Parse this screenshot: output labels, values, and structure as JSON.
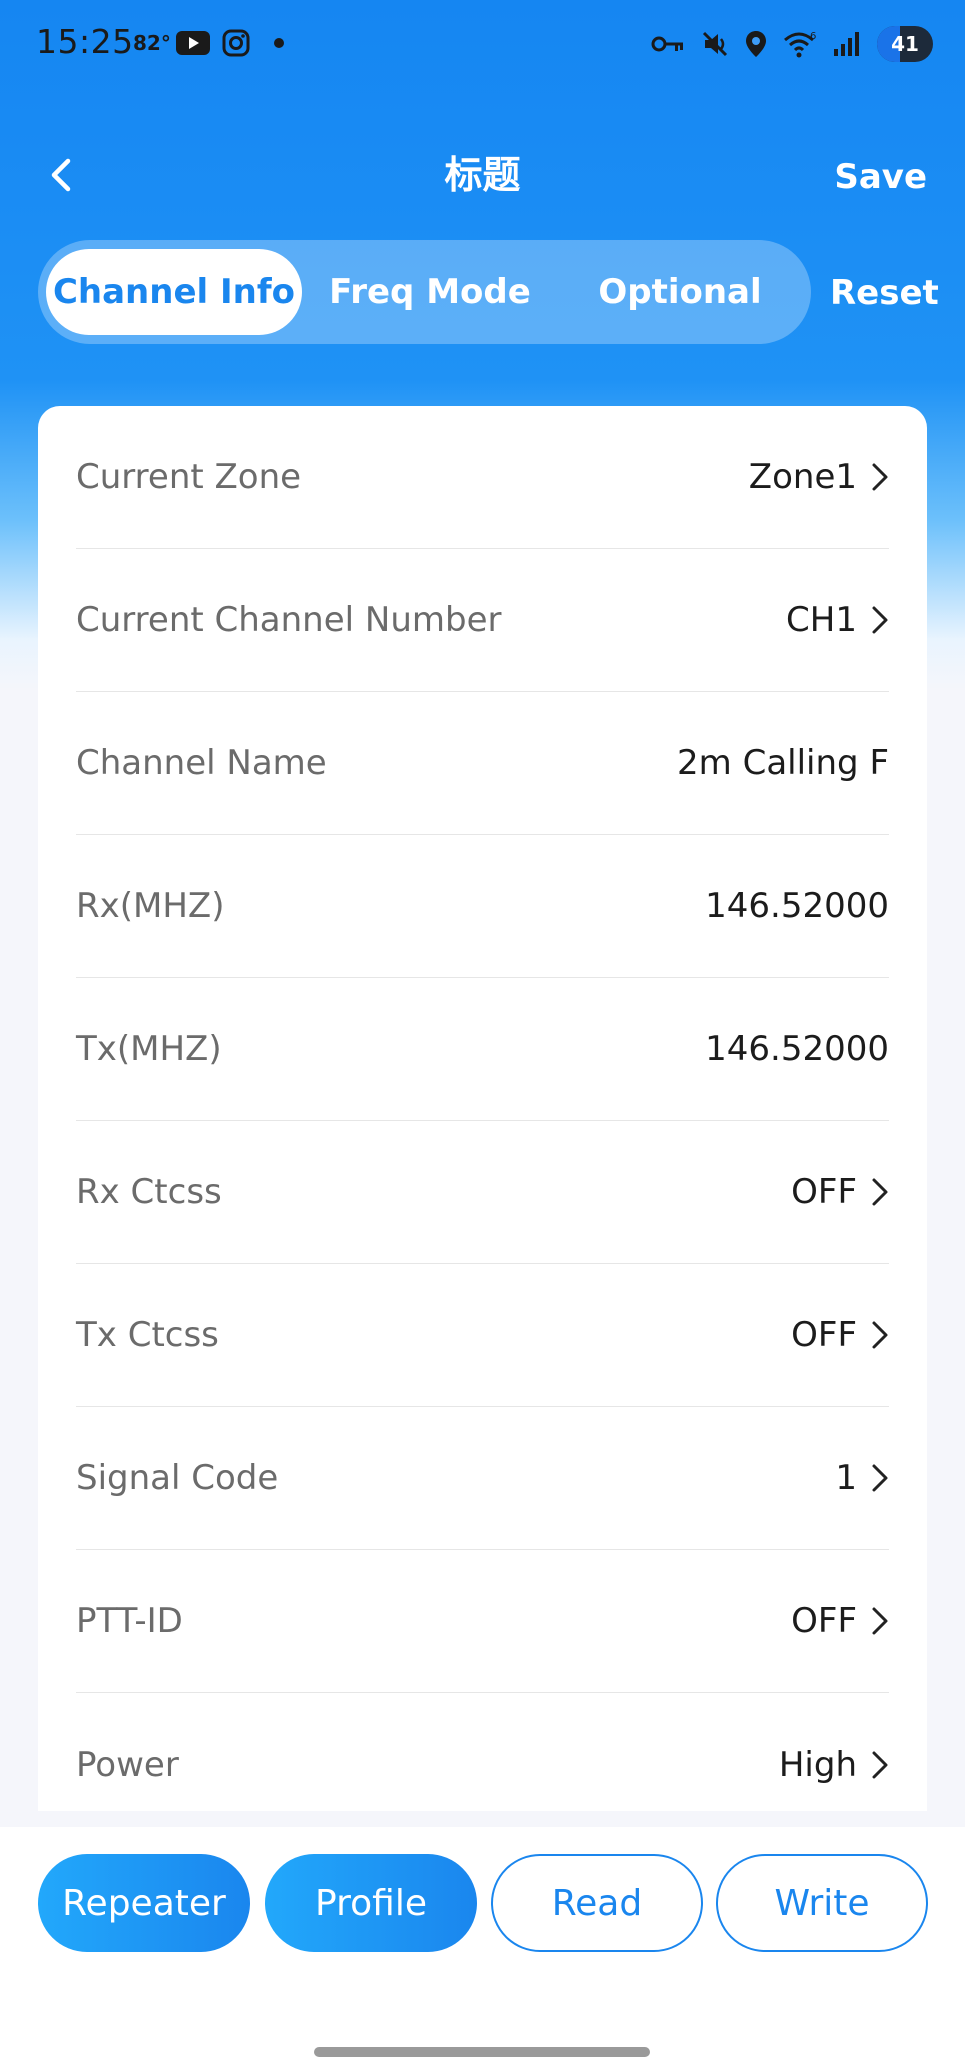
{
  "status_bar": {
    "time": "15:25",
    "temperature": "82°",
    "battery_level": 41,
    "battery_label": "41",
    "icons": [
      "youtube-icon",
      "instagram-icon",
      "vpn-key-icon",
      "vibrate-mute-icon",
      "location-icon",
      "wifi-icon",
      "signal-icon"
    ]
  },
  "header": {
    "title": "标题",
    "save_label": "Save",
    "reset_label": "Reset"
  },
  "tabs": [
    {
      "label": "Channel Info",
      "active": true
    },
    {
      "label": "Freq Mode",
      "active": false
    },
    {
      "label": "Optional",
      "active": false
    }
  ],
  "rows": [
    {
      "label": "Current Zone",
      "value": "Zone1",
      "chevron": true
    },
    {
      "label": "Current Channel Number",
      "value": "CH1",
      "chevron": true
    },
    {
      "label": "Channel Name",
      "value": "2m Calling F",
      "chevron": false
    },
    {
      "label": "Rx(MHZ)",
      "value": "146.52000",
      "chevron": false
    },
    {
      "label": "Tx(MHZ)",
      "value": "146.52000",
      "chevron": false
    },
    {
      "label": "Rx Ctcss",
      "value": "OFF",
      "chevron": true
    },
    {
      "label": "Tx Ctcss",
      "value": "OFF",
      "chevron": true
    },
    {
      "label": "Signal Code",
      "value": "1",
      "chevron": true
    },
    {
      "label": "PTT-ID",
      "value": "OFF",
      "chevron": true
    },
    {
      "label": "Power",
      "value": "High",
      "chevron": true
    }
  ],
  "bottom_buttons": [
    {
      "label": "Repeater",
      "style": "filled"
    },
    {
      "label": "Profile",
      "style": "filled"
    },
    {
      "label": "Read",
      "style": "outline"
    },
    {
      "label": "Write",
      "style": "outline"
    }
  ],
  "colors": {
    "accent": "#1a86ee",
    "header_blue": "#1586f2",
    "label_gray": "#6b6b6b"
  }
}
